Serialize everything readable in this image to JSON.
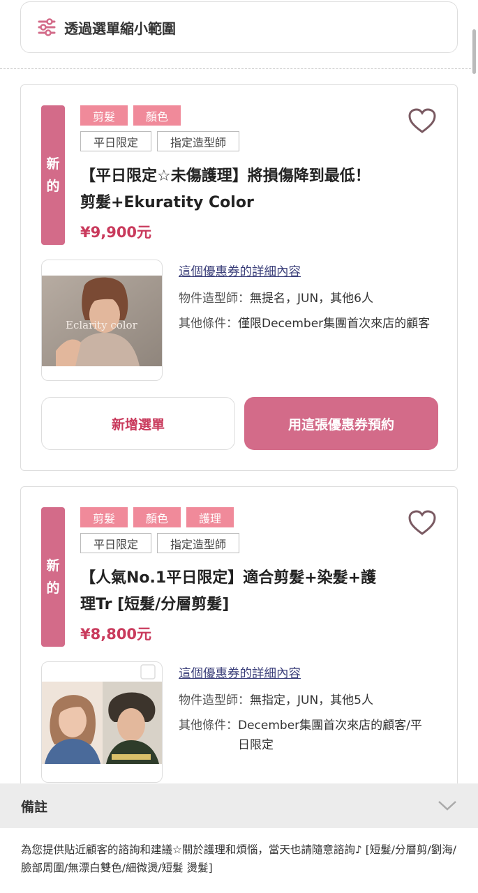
{
  "filter": {
    "label": "透過選單縮小範圍",
    "icon": "sliders-icon"
  },
  "coupons": [
    {
      "badge": "新的",
      "categories": [
        "剪髮",
        "顏色"
      ],
      "conditions": [
        "平日限定",
        "指定造型師"
      ],
      "title": "【平日限定☆未傷護理】將損傷降到最低！ 剪髮+Ekuratity Color",
      "price": "¥9,900元",
      "image_caption": "Eclarity color",
      "detail_link": "這個優惠券的詳細內容",
      "stylist_label": "物件造型師：",
      "stylist_value": "無提名，JUN，其他6人",
      "other_label": "其他條件：",
      "other_value": "僅限December集團首次來店的顧客",
      "add_label": "新增選單",
      "book_label": "用這張優惠券預約"
    },
    {
      "badge": "新的",
      "categories": [
        "剪髮",
        "顏色",
        "護理"
      ],
      "conditions": [
        "平日限定",
        "指定造型師"
      ],
      "title": "【人氣No.1平日限定】適合剪髮+染髮+護理Tr [短髮/分層剪髮]",
      "price": "¥8,800元",
      "detail_link": "這個優惠券的詳細內容",
      "stylist_label": "物件造型師：",
      "stylist_value": "無指定，JUN，其他5人",
      "other_label": "其他條件：",
      "other_value": "December集團首次來店的顧客/平日限定"
    }
  ],
  "notes": {
    "title": "備註",
    "body": "為您提供貼近顧客的諮詢和建議☆關於護理和煩惱，當天也請隨意諮詢♪ [短髮/分層剪/劉海/臉部周圍/無漂白雙色/細微燙/短髮 燙髮]"
  },
  "colors": {
    "accent": "#d36b89",
    "price": "#c93a5c",
    "tag": "#f08a9a",
    "link": "#3b3f7a"
  }
}
